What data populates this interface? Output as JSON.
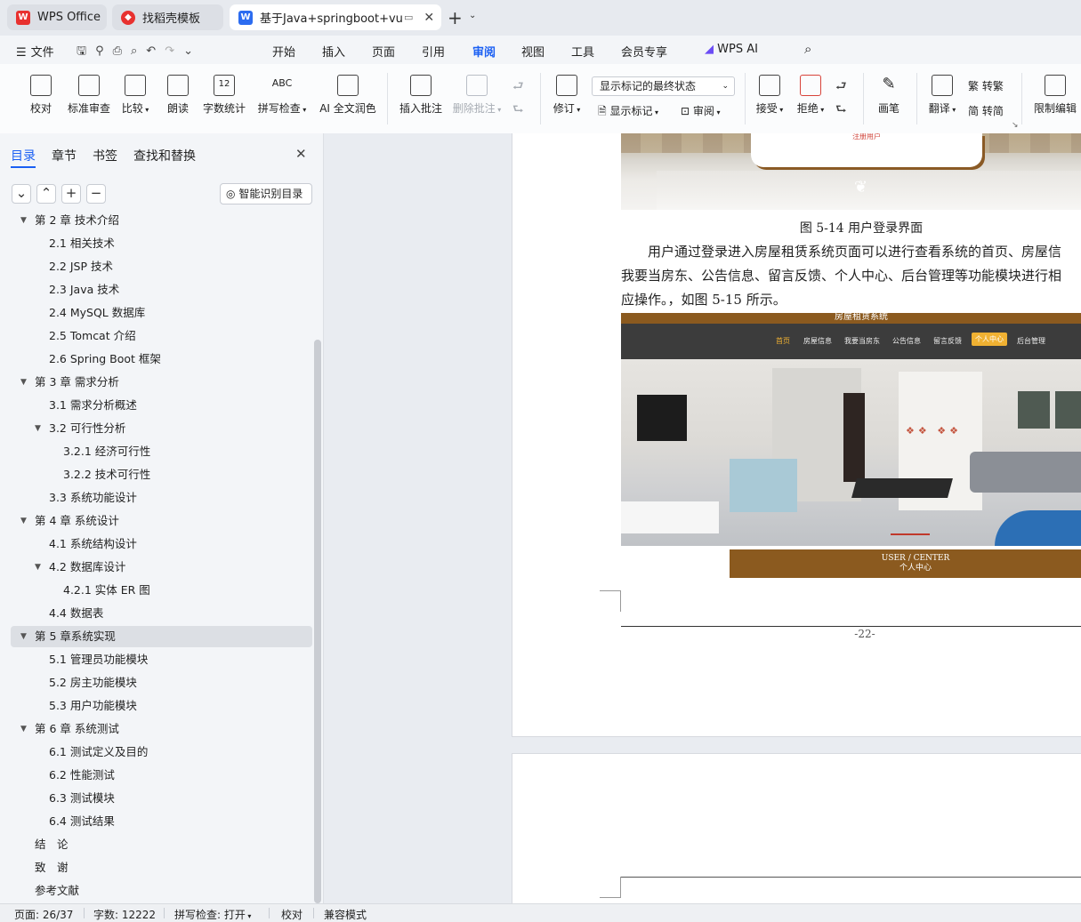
{
  "tabs": [
    {
      "label": "WPS Office"
    },
    {
      "label": "找稻壳模板"
    },
    {
      "label": "基于Java+springboot+vue"
    }
  ],
  "menu": {
    "file": "文件",
    "items": [
      "开始",
      "插入",
      "页面",
      "引用",
      "审阅",
      "视图",
      "工具",
      "会员专享"
    ],
    "active": "审阅",
    "ai": "WPS AI"
  },
  "ribbon": {
    "proofread": "校对",
    "standard_review": "标准审查",
    "compare": "比较",
    "read_aloud": "朗读",
    "word_count": "字数统计",
    "spell_check": "拼写检查",
    "ai_polish": "AI 全文润色",
    "insert_comment": "插入批注",
    "delete_comment": "删除批注",
    "track_changes": "修订",
    "markup_state": "显示标记的最终状态",
    "show_markup": "显示标记",
    "review": "审阅",
    "accept": "接受",
    "reject": "拒绝",
    "pen": "画笔",
    "translate": "翻译",
    "to_traditional": "转繁",
    "to_simplified": "转简",
    "restrict_edit": "限制编辑",
    "word_count_icon_text": "12",
    "spell_icon_text": "ABC"
  },
  "sidebar": {
    "tabs": [
      "目录",
      "章节",
      "书签",
      "查找和替换"
    ],
    "smart_toc": "智能识别目录",
    "toc": [
      {
        "label": "第 2 章 技术介绍",
        "level": 0,
        "expanded": true
      },
      {
        "label": "2.1 相关技术",
        "level": 1
      },
      {
        "label": "2.2 JSP 技术",
        "level": 1
      },
      {
        "label": "2.3 Java 技术",
        "level": 1
      },
      {
        "label": "2.4 MySQL 数据库",
        "level": 1
      },
      {
        "label": "2.5 Tomcat 介绍",
        "level": 1
      },
      {
        "label": "2.6 Spring Boot 框架",
        "level": 1
      },
      {
        "label": "第 3 章 需求分析",
        "level": 0,
        "expanded": true
      },
      {
        "label": "3.1 需求分析概述",
        "level": 1
      },
      {
        "label": "3.2 可行性分析",
        "level": 1,
        "expanded": true
      },
      {
        "label": "3.2.1 经济可行性",
        "level": 2
      },
      {
        "label": "3.2.2 技术可行性",
        "level": 2
      },
      {
        "label": "3.3 系统功能设计",
        "level": 1
      },
      {
        "label": "第 4 章 系统设计",
        "level": 0,
        "expanded": true
      },
      {
        "label": "4.1 系统结构设计",
        "level": 1
      },
      {
        "label": "4.2 数据库设计",
        "level": 1,
        "expanded": true
      },
      {
        "label": "4.2.1 实体 ER 图",
        "level": 2
      },
      {
        "label": "4.4 数据表",
        "level": 1
      },
      {
        "label": "第 5 章系统实现",
        "level": 0,
        "expanded": true,
        "selected": true
      },
      {
        "label": "5.1 管理员功能模块",
        "level": 1
      },
      {
        "label": "5.2 房主功能模块",
        "level": 1
      },
      {
        "label": "5.3 用户功能模块",
        "level": 1
      },
      {
        "label": "第 6 章 系统测试",
        "level": 0,
        "expanded": true
      },
      {
        "label": "6.1 测试定义及目的",
        "level": 1
      },
      {
        "label": "6.2 性能测试",
        "level": 1
      },
      {
        "label": "6.3 测试模块",
        "level": 1
      },
      {
        "label": "6.4 测试结果",
        "level": 1
      },
      {
        "label": "结　论",
        "level": 0
      },
      {
        "label": "致　谢",
        "level": 0
      },
      {
        "label": "参考文献",
        "level": 0
      }
    ]
  },
  "document": {
    "register_text": "注册用户",
    "figure_caption": "图 5-14  用户登录界面",
    "para_line1": "用户通过登录进入房屋租赁系统页面可以进行查看系统的首页、房屋信",
    "para_line2": "我要当房东、公告信息、留言反馈、个人中心、后台管理等功能模块进行相",
    "para_line3": "应操作。，如图 5-15 所示。",
    "screenshot": {
      "site_title": "房屋租赁系统",
      "nav": [
        "首页",
        "房屋信息",
        "我要当房东",
        "公告信息",
        "留言反馈",
        "个人中心",
        "后台管理"
      ],
      "center_en": "USER / CENTER",
      "center_cn": "个人中心"
    },
    "page_number": "-22-"
  },
  "status": {
    "page": "页面: 26/37",
    "words": "字数: 12222",
    "spell": "拼写检查: 打开",
    "proof": "校对",
    "compat": "兼容模式"
  }
}
